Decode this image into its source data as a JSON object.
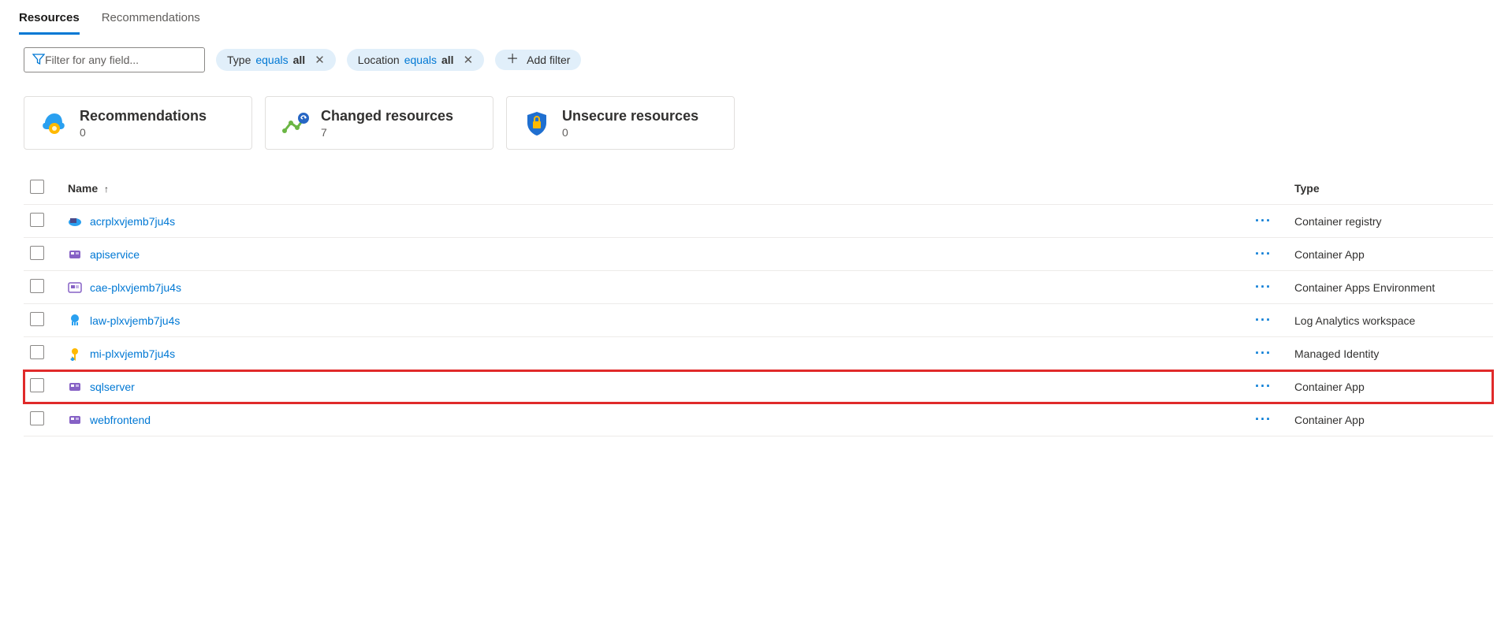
{
  "tabs": {
    "resources": "Resources",
    "recommendations": "Recommendations",
    "active": "resources"
  },
  "filter": {
    "placeholder": "Filter for any field..."
  },
  "pills": [
    {
      "label": "Type",
      "op": "equals",
      "val": "all",
      "closable": true
    },
    {
      "label": "Location",
      "op": "equals",
      "val": "all",
      "closable": true
    }
  ],
  "addFilter": {
    "label": "Add filter"
  },
  "cards": {
    "recommendations": {
      "title": "Recommendations",
      "count": "0"
    },
    "changed": {
      "title": "Changed resources",
      "count": "7"
    },
    "unsecure": {
      "title": "Unsecure resources",
      "count": "0"
    }
  },
  "table": {
    "headers": {
      "name": "Name",
      "type": "Type"
    },
    "rows": [
      {
        "name": "acrplxvjemb7ju4s",
        "type": "Container registry",
        "icon": "container-registry",
        "highlighted": false
      },
      {
        "name": "apiservice",
        "type": "Container App",
        "icon": "container-app",
        "highlighted": false
      },
      {
        "name": "cae-plxvjemb7ju4s",
        "type": "Container Apps Environment",
        "icon": "container-env",
        "highlighted": false
      },
      {
        "name": "law-plxvjemb7ju4s",
        "type": "Log Analytics workspace",
        "icon": "log-analytics",
        "highlighted": false
      },
      {
        "name": "mi-plxvjemb7ju4s",
        "type": "Managed Identity",
        "icon": "managed-identity",
        "highlighted": false
      },
      {
        "name": "sqlserver",
        "type": "Container App",
        "icon": "container-app",
        "highlighted": true
      },
      {
        "name": "webfrontend",
        "type": "Container App",
        "icon": "container-app",
        "highlighted": false
      }
    ]
  }
}
